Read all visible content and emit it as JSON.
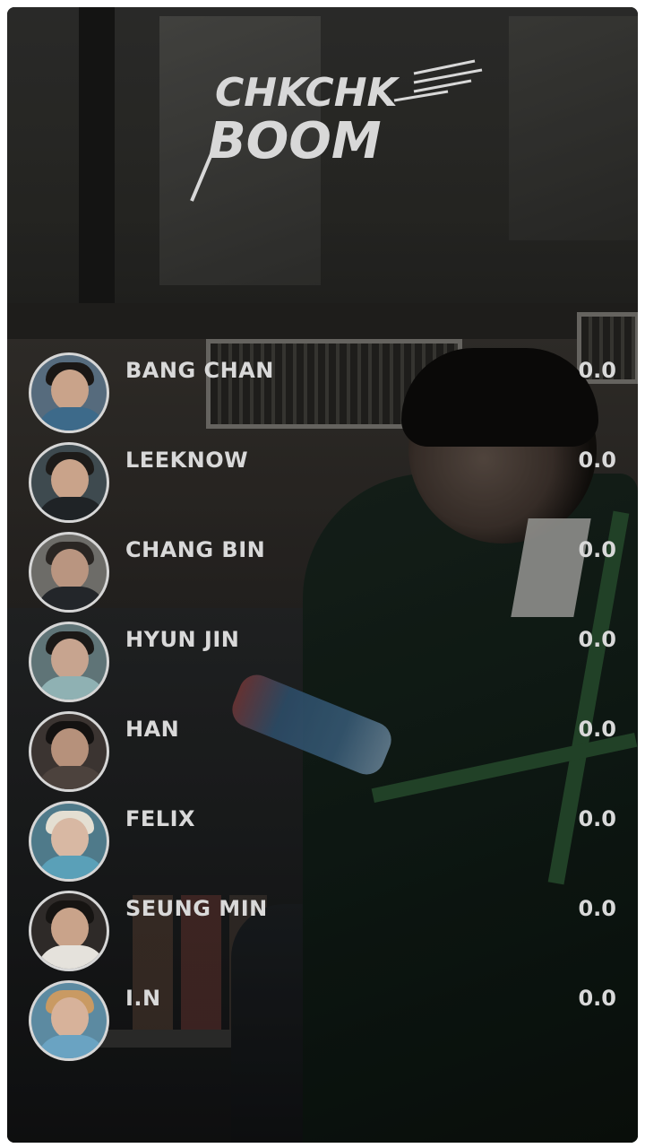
{
  "logo": {
    "line1": "CHKCHK",
    "line2": "BOOM"
  },
  "members": [
    {
      "name": "BANG CHAN",
      "score": "0.0",
      "avatar_icon": "bang-chan-avatar-icon"
    },
    {
      "name": "LEEKNOW",
      "score": "0.0",
      "avatar_icon": "leeknow-avatar-icon"
    },
    {
      "name": "CHANG BIN",
      "score": "0.0",
      "avatar_icon": "chang-bin-avatar-icon"
    },
    {
      "name": "HYUN JIN",
      "score": "0.0",
      "avatar_icon": "hyun-jin-avatar-icon"
    },
    {
      "name": "HAN",
      "score": "0.0",
      "avatar_icon": "han-avatar-icon"
    },
    {
      "name": "FELIX",
      "score": "0.0",
      "avatar_icon": "felix-avatar-icon"
    },
    {
      "name": "SEUNG MIN",
      "score": "0.0",
      "avatar_icon": "seung-min-avatar-icon"
    },
    {
      "name": "I.N",
      "score": "0.0",
      "avatar_icon": "i-n-avatar-icon"
    }
  ],
  "colors": {
    "text": "#d9d9d9",
    "avatar_border": "#d6d6d6",
    "logo": "#d8d8d8"
  }
}
